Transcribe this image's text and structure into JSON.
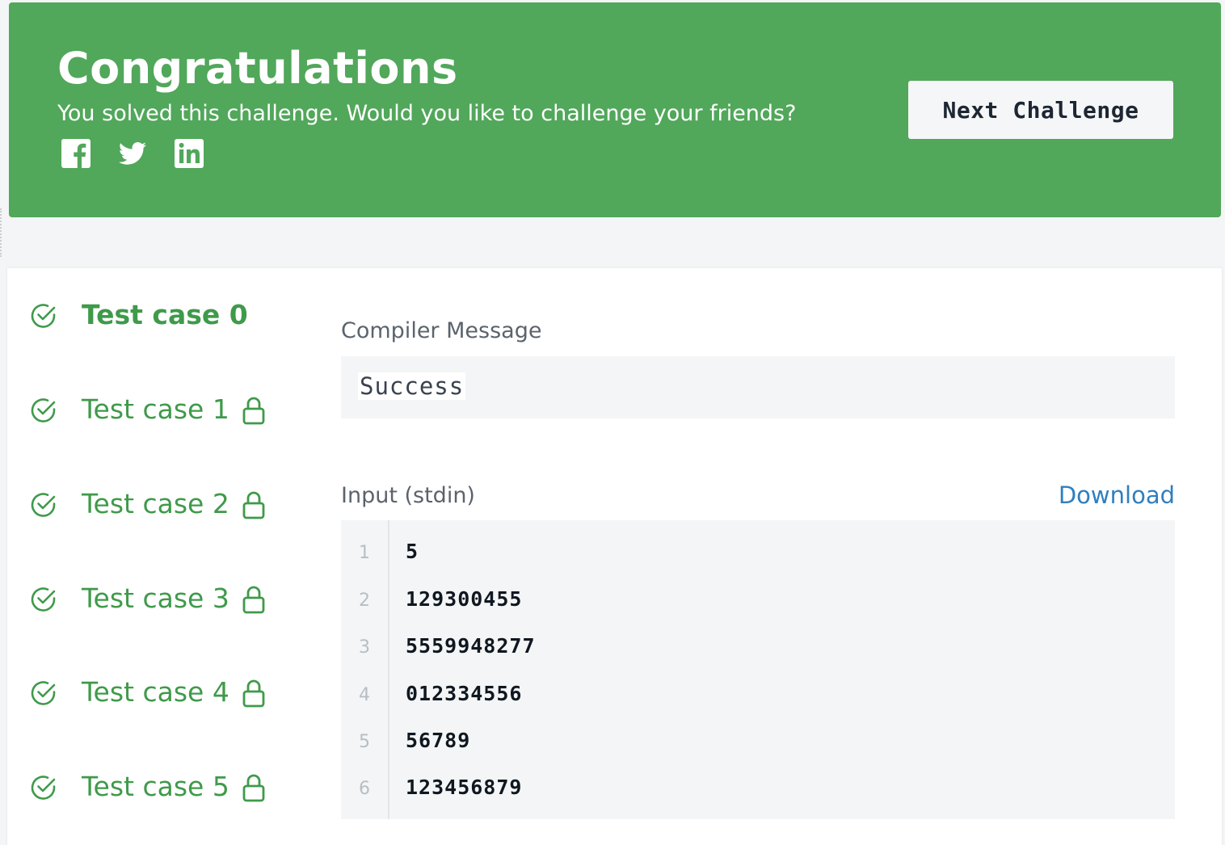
{
  "banner": {
    "title": "Congratulations",
    "subtitle": "You solved this challenge. Would you like to challenge your friends?",
    "share_icons": [
      "facebook-icon",
      "twitter-icon",
      "linkedin-icon"
    ],
    "next_button_label": "Next Challenge",
    "background_color": "#51a75a"
  },
  "test_cases": [
    {
      "label": "Test case 0",
      "passed": true,
      "locked": false,
      "active": true
    },
    {
      "label": "Test case 1",
      "passed": true,
      "locked": true,
      "active": false
    },
    {
      "label": "Test case 2",
      "passed": true,
      "locked": true,
      "active": false
    },
    {
      "label": "Test case 3",
      "passed": true,
      "locked": true,
      "active": false
    },
    {
      "label": "Test case 4",
      "passed": true,
      "locked": true,
      "active": false
    },
    {
      "label": "Test case 5",
      "passed": true,
      "locked": true,
      "active": false
    }
  ],
  "compiler": {
    "label": "Compiler Message",
    "message": "Success"
  },
  "input": {
    "label": "Input (stdin)",
    "download_label": "Download",
    "lines": [
      {
        "no": "1",
        "text": "5"
      },
      {
        "no": "2",
        "text": "129300455"
      },
      {
        "no": "3",
        "text": "5559948277"
      },
      {
        "no": "4",
        "text": "012334556"
      },
      {
        "no": "5",
        "text": "56789"
      },
      {
        "no": "6",
        "text": "123456879"
      }
    ]
  },
  "colors": {
    "success_green": "#3f9a4a",
    "link_blue": "#2f7fbf"
  }
}
